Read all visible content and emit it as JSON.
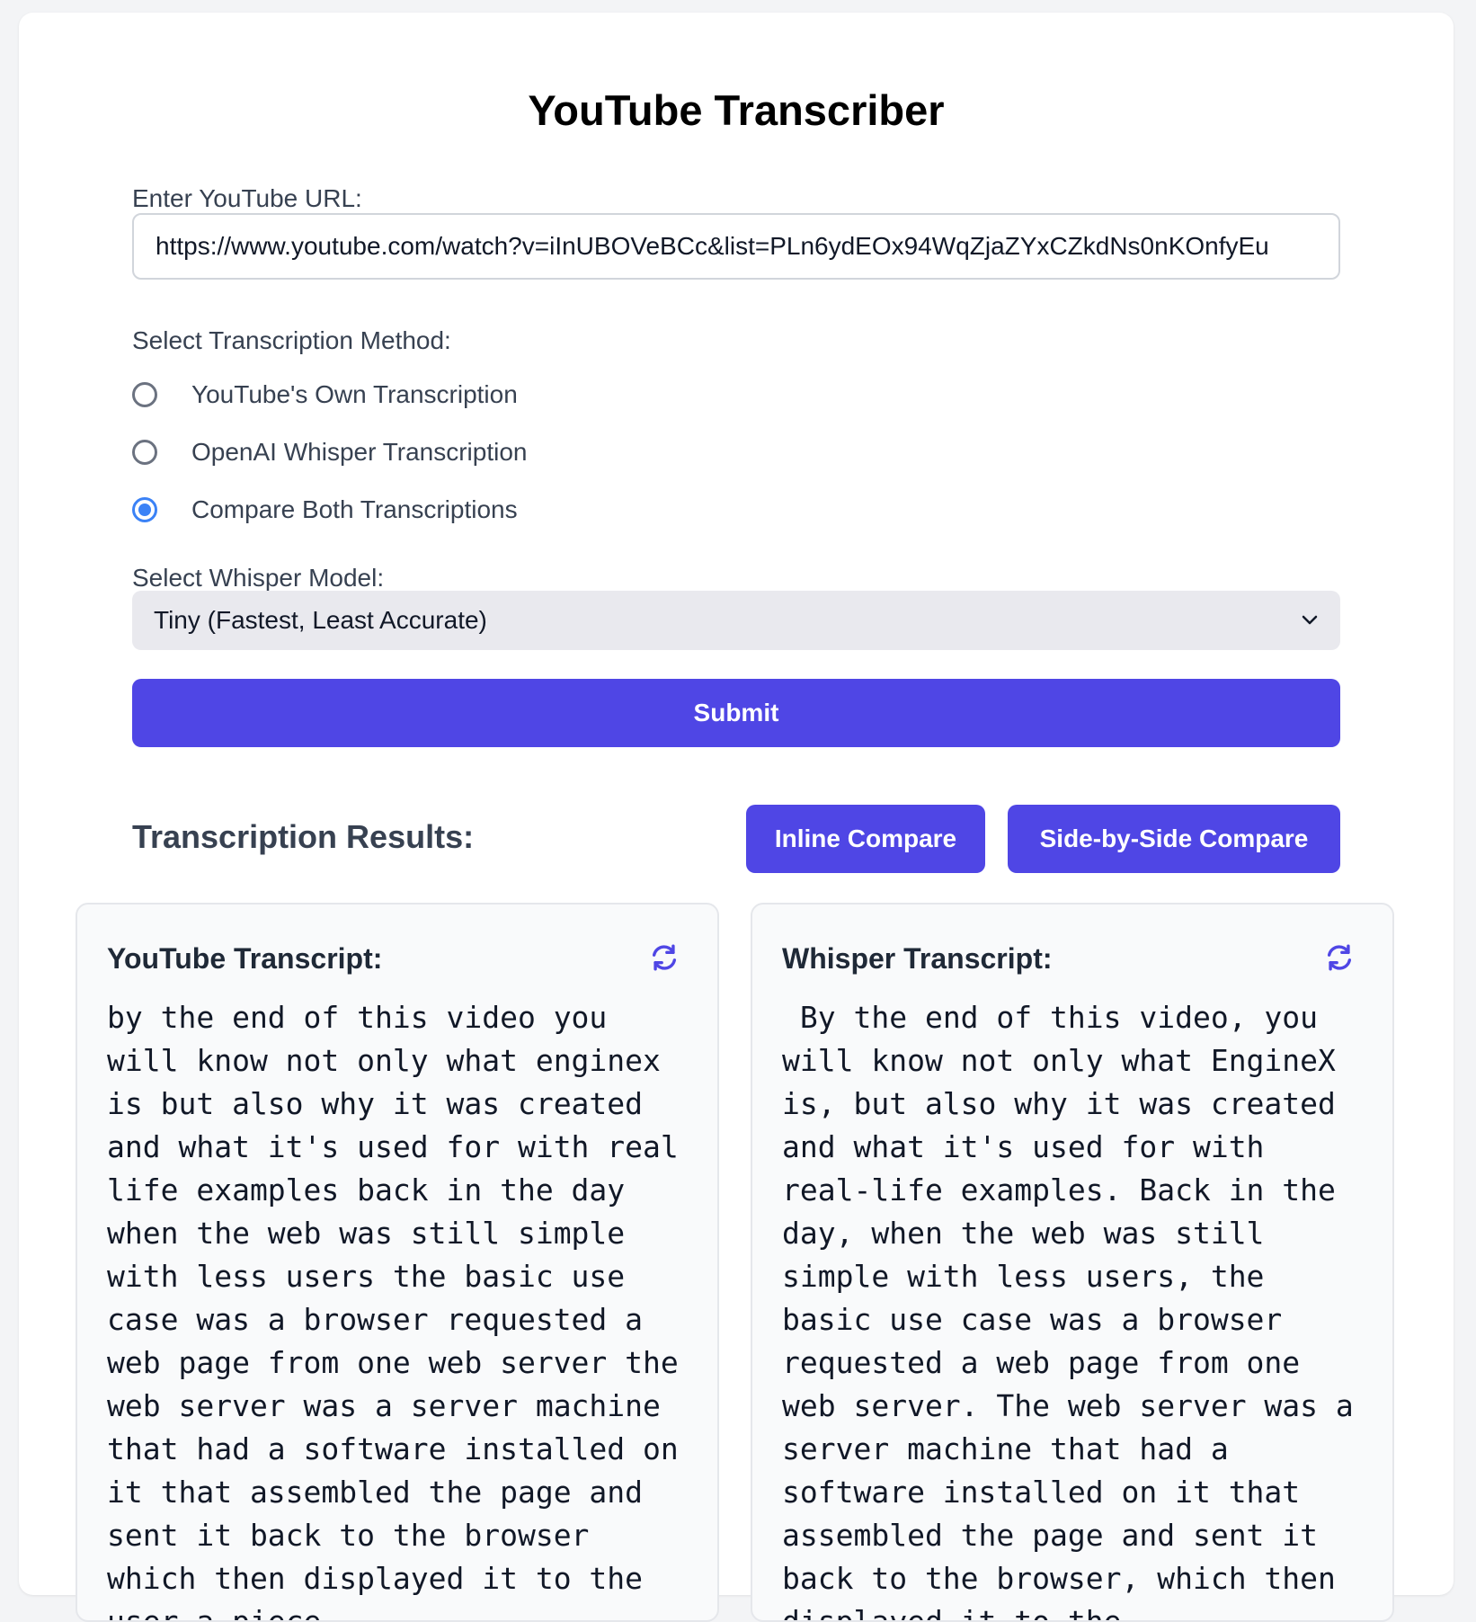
{
  "app": {
    "title": "YouTube Transcriber"
  },
  "form": {
    "url_label": "Enter YouTube URL:",
    "url_value": "https://www.youtube.com/watch?v=iInUBOVeBCc&list=PLn6ydEOx94WqZjaZYxCZkdNs0nKOnfyEu",
    "method_label": "Select Transcription Method:",
    "methods": [
      {
        "label": "YouTube's Own Transcription",
        "checked": false
      },
      {
        "label": "OpenAI Whisper Transcription",
        "checked": false
      },
      {
        "label": "Compare Both Transcriptions",
        "checked": true
      }
    ],
    "model_label": "Select Whisper Model:",
    "model_selected": "Tiny (Fastest, Least Accurate)",
    "submit_label": "Submit"
  },
  "results": {
    "title": "Transcription Results:",
    "inline_compare_label": "Inline Compare",
    "side_by_side_label": "Side-by-Side Compare",
    "youtube": {
      "title": "YouTube Transcript:",
      "icon": "refresh-icon",
      "text": "by the end of this video you will know not only what enginex is but also why it was created and what it's used for with real life examples back in the day when the web was still simple with less users the basic use case was a browser requested a web page from one web server the web server was a server machine that had a software installed on it that assembled the page and sent it back to the browser which then displayed it to the user a piece"
    },
    "whisper": {
      "title": "Whisper Transcript:",
      "icon": "refresh-icon",
      "text": " By the end of this video, you will know not only what EngineX is, but also why it was created and what it's used for with real-life examples. Back in the day, when the web was still simple with less users, the basic use case was a browser requested a web page from one web server. The web server was a server machine that had a software installed on it that assembled the page and sent it back to the browser, which then displayed it to the"
    }
  },
  "colors": {
    "accent": "#4f46e5",
    "radio_checked": "#3b82f6",
    "page_bg": "#f3f4f6"
  }
}
